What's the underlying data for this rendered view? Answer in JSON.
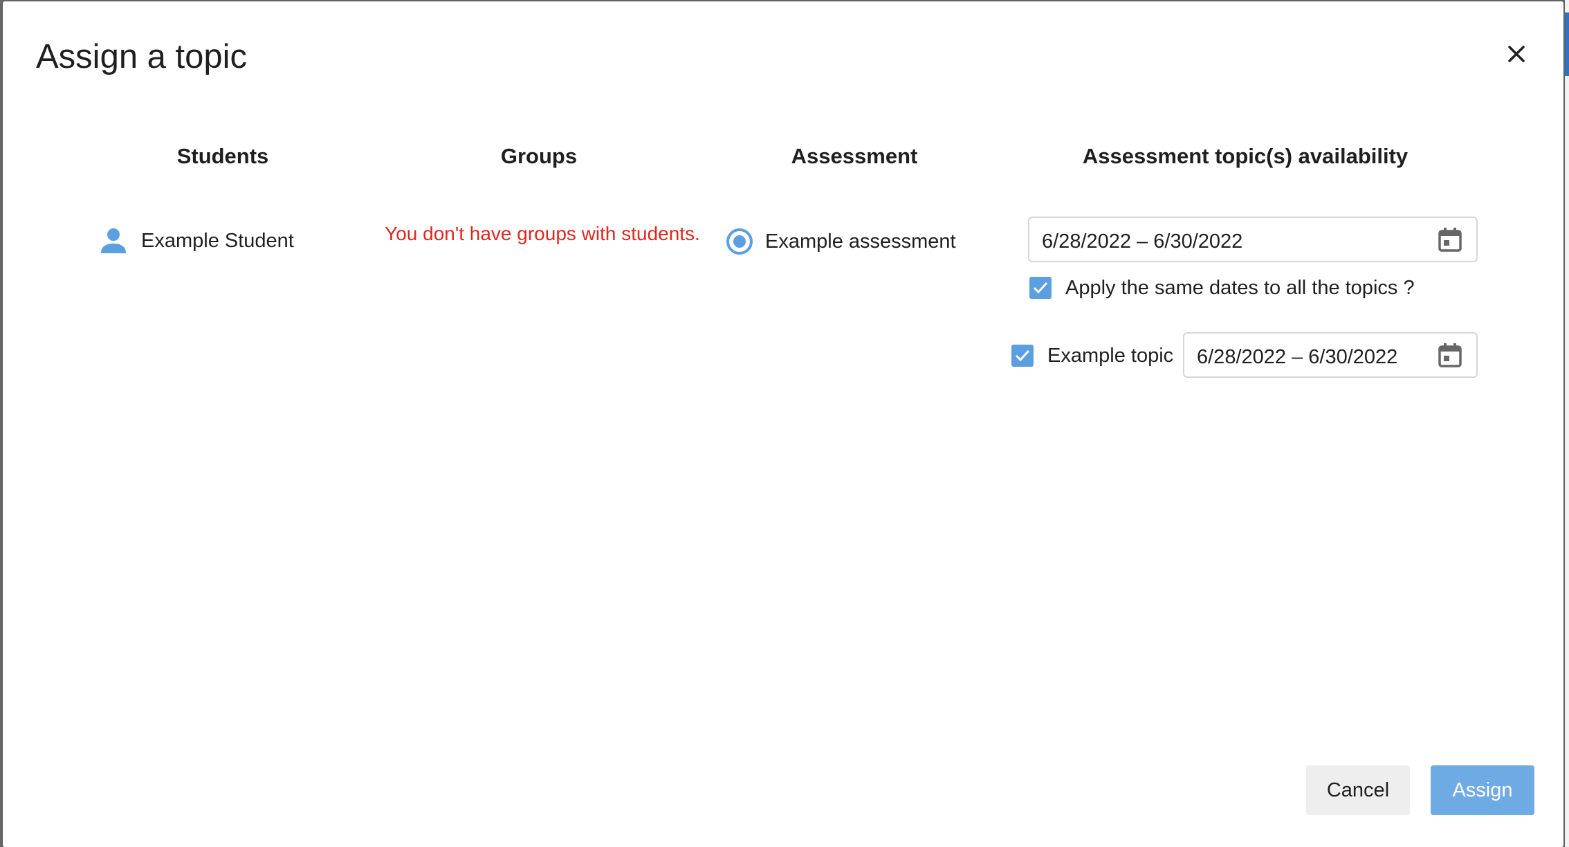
{
  "dialog": {
    "title": "Assign a topic"
  },
  "columns": {
    "students": "Students",
    "groups": "Groups",
    "assessment": "Assessment",
    "availability": "Assessment topic(s) availability"
  },
  "students": {
    "items": [
      {
        "name": "Example Student",
        "icon": "person-icon"
      }
    ]
  },
  "groups": {
    "empty_message": "You don't have groups with students."
  },
  "assessment": {
    "selected": "Example assessment"
  },
  "availability": {
    "date_range": "6/28/2022 – 6/30/2022",
    "apply_same_label": "Apply the same dates to all the topics ?",
    "apply_same_checked": true,
    "topics": [
      {
        "label": "Example topic",
        "checked": true,
        "date_range": "6/28/2022 – 6/30/2022"
      }
    ]
  },
  "footer": {
    "cancel_label": "Cancel",
    "assign_label": "Assign"
  },
  "colors": {
    "accent": "#5b9fe0",
    "error": "#e0271f",
    "primary_button": "#6eaae4"
  }
}
